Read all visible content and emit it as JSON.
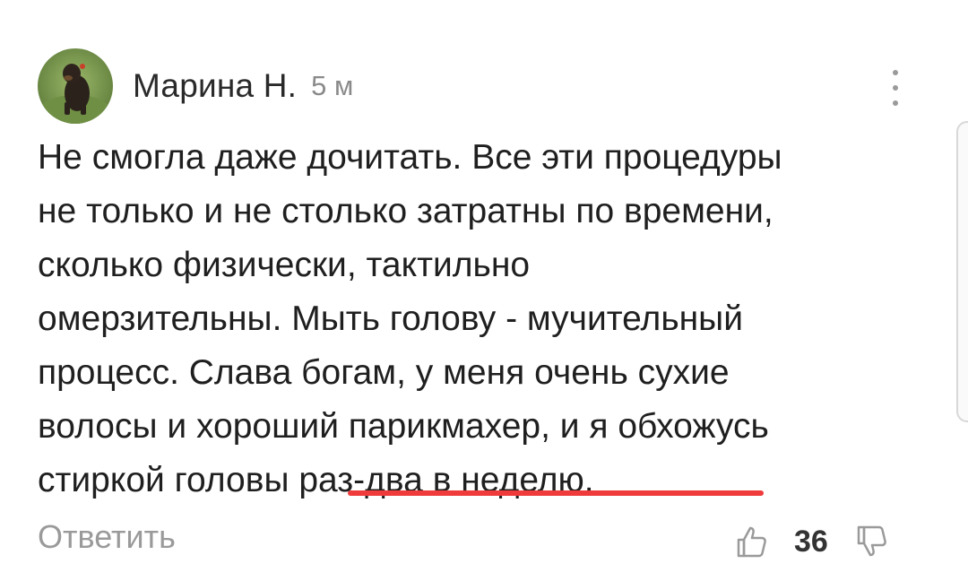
{
  "comment": {
    "author": "Марина Н.",
    "time_ago": "5 м",
    "text_lines": [
      "Не смогла даже дочитать. Все эти процедуры",
      "не только и не столько затратны по времени,",
      "сколько физически, тактильно",
      "омерзительны. Мыть голову - мучительный",
      "процесс. Слава богам, у меня очень сухие",
      "волосы и хороший парикмахер, и я обхожусь",
      "стиркой головы раз-два в неделю."
    ],
    "highlight_color": "#ef3b3b",
    "reply_label": "Ответить",
    "score": "36",
    "icons": {
      "menu": "more-vertical-icon",
      "like": "thumbs-up-icon",
      "dislike": "thumbs-down-icon"
    }
  }
}
